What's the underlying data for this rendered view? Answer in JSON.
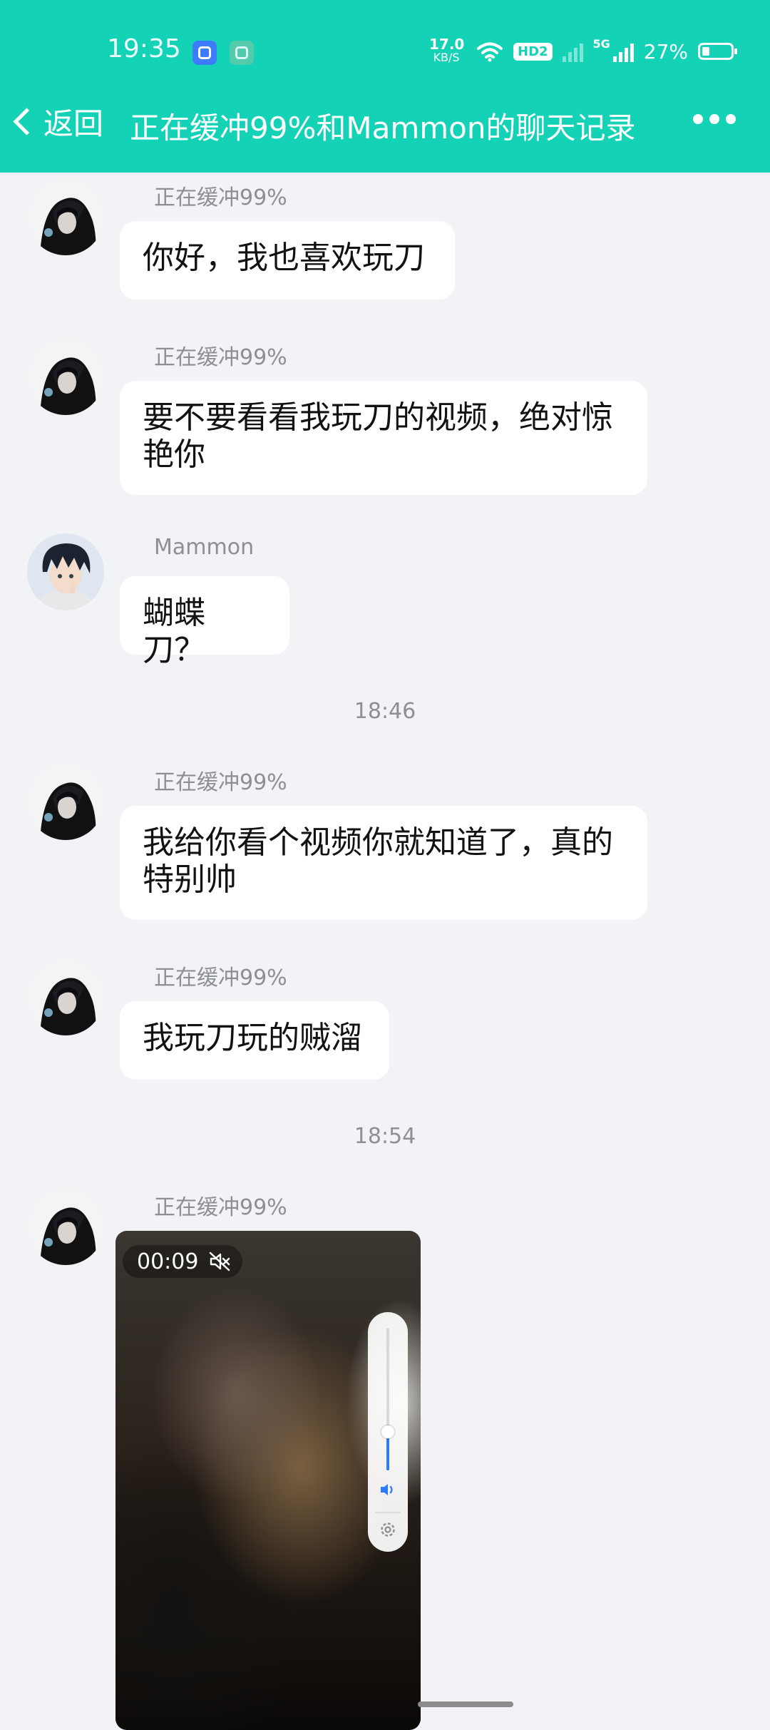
{
  "status_bar": {
    "time": "19:35",
    "net_speed_value": "17.0",
    "net_speed_unit": "KB/S",
    "hd_badge": "HD2",
    "network_tag": "5G",
    "battery_percent": "27%",
    "battery_level": 0.27,
    "icons": [
      "app-notification-icon",
      "app-notification-icon",
      "wifi-icon",
      "hd-icon",
      "no-signal-icon",
      "cellular-signal-icon",
      "battery-icon"
    ]
  },
  "header": {
    "back_label": "返回",
    "title": "正在缓冲99%和Mammon的聊天记录",
    "more_icon": "more-dots-icon",
    "background": "#13d2b6"
  },
  "messages": [
    {
      "sender": "正在缓冲99%",
      "text": "你好，我也喜欢玩刀"
    },
    {
      "sender": "正在缓冲99%",
      "text": "要不要看看我玩刀的视频，绝对惊艳你"
    },
    {
      "sender": "Mammon",
      "text": "蝴蝶刀？"
    },
    {
      "sender": "正在缓冲99%",
      "text": "我给你看个视频你就知道了，真的特别帅"
    },
    {
      "sender": "正在缓冲99%",
      "text": "我玩刀玩的贼溜"
    },
    {
      "sender": "正在缓冲99%"
    }
  ],
  "time_dividers": [
    "18:46",
    "18:54"
  ],
  "video": {
    "duration": "00:09",
    "muted": true,
    "volume_level": 0.27,
    "icons": [
      "mute-icon",
      "speaker-icon",
      "settings-gear-icon"
    ]
  },
  "colors": {
    "accent": "#13d2b6",
    "chat_background": "#f2f3f7",
    "bubble": "#ffffff",
    "volume_fill": "#2f7cf6"
  }
}
